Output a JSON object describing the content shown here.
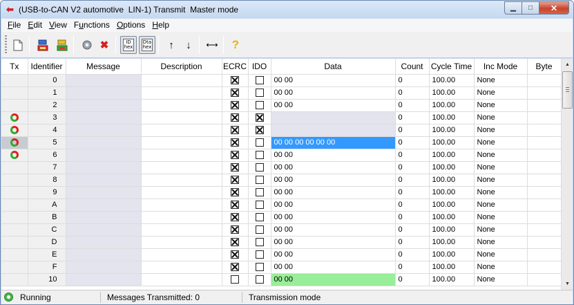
{
  "window": {
    "title": "(USB-to-CAN V2 automotive  LIN-1) Transmit  Master mode",
    "icon": "app-icon",
    "controls": {
      "minimize": "minimize-icon",
      "maximize": "maximize-icon",
      "close": "close-icon"
    }
  },
  "menu": {
    "items": [
      {
        "label": "File",
        "ul": "F",
        "rest": "ile"
      },
      {
        "label": "Edit",
        "ul": "E",
        "rest": "dit"
      },
      {
        "label": "View",
        "ul": "V",
        "rest": "iew"
      },
      {
        "label": "Functions",
        "pre": "F",
        "ul": "u",
        "rest": "nctions"
      },
      {
        "label": "Options",
        "ul": "O",
        "rest": "ptions"
      },
      {
        "label": "Help",
        "ul": "H",
        "rest": "elp"
      }
    ]
  },
  "toolbar": {
    "id_hex_top": "ID",
    "id_hex_bottom": "hex",
    "data_hex_top": "Dta",
    "data_hex_bottom": "hex"
  },
  "grid": {
    "columns": [
      "Tx",
      "Identifier",
      "Message",
      "Description",
      "ECRC",
      "IDO",
      "Data",
      "Count",
      "Cycle Time",
      "Inc Mode",
      "Byte"
    ],
    "rows": [
      {
        "tx": "",
        "id": "0",
        "message": "",
        "description": "",
        "ecrc": true,
        "ido": false,
        "data": "00 00",
        "data_style": "",
        "count": "0",
        "cycle": "100.00",
        "inc": "None",
        "byte": ""
      },
      {
        "tx": "",
        "id": "1",
        "message": "",
        "description": "",
        "ecrc": true,
        "ido": false,
        "data": "00 00",
        "data_style": "",
        "count": "0",
        "cycle": "100.00",
        "inc": "None",
        "byte": ""
      },
      {
        "tx": "",
        "id": "2",
        "message": "",
        "description": "",
        "ecrc": true,
        "ido": false,
        "data": "00 00",
        "data_style": "",
        "count": "0",
        "cycle": "100.00",
        "inc": "None",
        "byte": ""
      },
      {
        "tx": "cycle",
        "id": "3",
        "message": "",
        "description": "",
        "ecrc": true,
        "ido": true,
        "data": "",
        "data_style": "grey",
        "count": "0",
        "cycle": "100.00",
        "inc": "None",
        "byte": ""
      },
      {
        "tx": "cycle",
        "id": "4",
        "message": "",
        "description": "",
        "ecrc": true,
        "ido": true,
        "data": "",
        "data_style": "grey",
        "count": "0",
        "cycle": "100.00",
        "inc": "None",
        "byte": ""
      },
      {
        "tx": "cycle",
        "id": "5",
        "message": "",
        "description": "",
        "ecrc": true,
        "ido": false,
        "data": "00 00 00 00 00 00",
        "data_style": "sel",
        "count": "0",
        "cycle": "100.00",
        "inc": "None",
        "byte": "",
        "selected": true
      },
      {
        "tx": "cycle",
        "id": "6",
        "message": "",
        "description": "",
        "ecrc": true,
        "ido": false,
        "data": "00 00",
        "data_style": "",
        "count": "0",
        "cycle": "100.00",
        "inc": "None",
        "byte": ""
      },
      {
        "tx": "",
        "id": "7",
        "message": "",
        "description": "",
        "ecrc": true,
        "ido": false,
        "data": "00 00",
        "data_style": "",
        "count": "0",
        "cycle": "100.00",
        "inc": "None",
        "byte": ""
      },
      {
        "tx": "",
        "id": "8",
        "message": "",
        "description": "",
        "ecrc": true,
        "ido": false,
        "data": "00 00",
        "data_style": "",
        "count": "0",
        "cycle": "100.00",
        "inc": "None",
        "byte": ""
      },
      {
        "tx": "",
        "id": "9",
        "message": "",
        "description": "",
        "ecrc": true,
        "ido": false,
        "data": "00 00",
        "data_style": "",
        "count": "0",
        "cycle": "100.00",
        "inc": "None",
        "byte": ""
      },
      {
        "tx": "",
        "id": "A",
        "message": "",
        "description": "",
        "ecrc": true,
        "ido": false,
        "data": "00 00",
        "data_style": "",
        "count": "0",
        "cycle": "100.00",
        "inc": "None",
        "byte": ""
      },
      {
        "tx": "",
        "id": "B",
        "message": "",
        "description": "",
        "ecrc": true,
        "ido": false,
        "data": "00 00",
        "data_style": "",
        "count": "0",
        "cycle": "100.00",
        "inc": "None",
        "byte": ""
      },
      {
        "tx": "",
        "id": "C",
        "message": "",
        "description": "",
        "ecrc": true,
        "ido": false,
        "data": "00 00",
        "data_style": "",
        "count": "0",
        "cycle": "100.00",
        "inc": "None",
        "byte": ""
      },
      {
        "tx": "",
        "id": "D",
        "message": "",
        "description": "",
        "ecrc": true,
        "ido": false,
        "data": "00 00",
        "data_style": "",
        "count": "0",
        "cycle": "100.00",
        "inc": "None",
        "byte": ""
      },
      {
        "tx": "",
        "id": "E",
        "message": "",
        "description": "",
        "ecrc": true,
        "ido": false,
        "data": "00 00",
        "data_style": "",
        "count": "0",
        "cycle": "100.00",
        "inc": "None",
        "byte": ""
      },
      {
        "tx": "",
        "id": "F",
        "message": "",
        "description": "",
        "ecrc": true,
        "ido": false,
        "data": "00 00",
        "data_style": "",
        "count": "0",
        "cycle": "100.00",
        "inc": "None",
        "byte": ""
      },
      {
        "tx": "",
        "id": "10",
        "message": "",
        "description": "",
        "ecrc": false,
        "ido": false,
        "data": "00 00",
        "data_style": "green",
        "count": "0",
        "cycle": "100.00",
        "inc": "None",
        "byte": ""
      }
    ]
  },
  "status": {
    "state": "Running",
    "messages_transmitted": "Messages Transmitted: 0",
    "mode": "Transmission mode"
  }
}
